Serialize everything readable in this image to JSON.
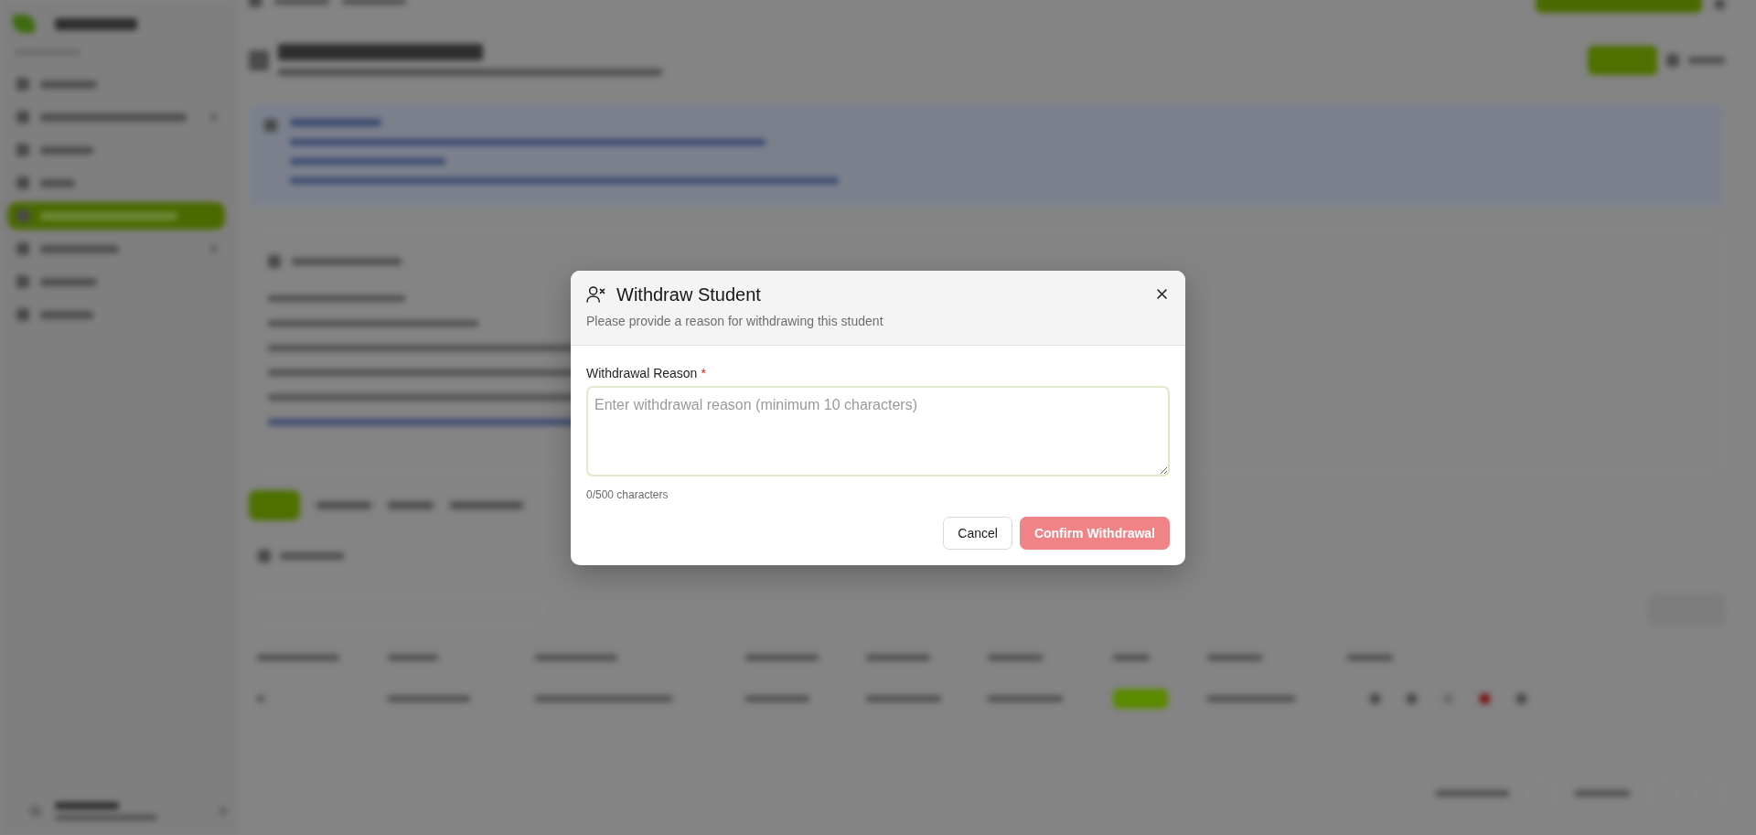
{
  "dialog": {
    "title": "Withdraw Student",
    "subtitle": "Please provide a reason for withdrawing this student",
    "field": {
      "label": "Withdrawal Reason",
      "required_mark": "*",
      "placeholder": "Enter withdrawal reason (minimum 10 characters)",
      "counter": "0/500 characters"
    },
    "buttons": [
      {
        "label": "Cancel",
        "kind": "secondary",
        "disabled": false
      },
      {
        "label": "Confirm Withdrawal",
        "kind": "danger",
        "disabled": true
      }
    ]
  }
}
